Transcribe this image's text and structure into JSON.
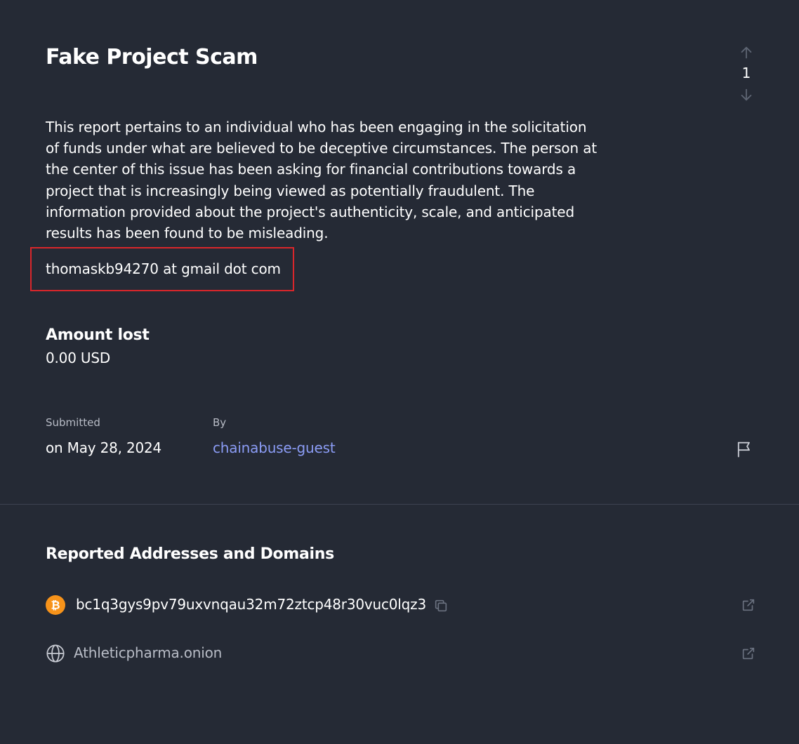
{
  "report": {
    "title": "Fake Project Scam",
    "description": "This report pertains to an individual who has been engaging in the solicitation of funds under what are believed to be deceptive circumstances. The person at the center of this issue has been asking for financial contributions towards a project that is increasingly being viewed as potentially fraudulent. The information provided about the project's authenticity, scale, and anticipated results has been found to be misleading.",
    "email": "thomaskb94270 at gmail dot com",
    "votes": "1"
  },
  "amount": {
    "label": "Amount lost",
    "value": "0.00 USD"
  },
  "meta": {
    "submitted_label": "Submitted",
    "submitted_value": "on May 28, 2024",
    "by_label": "By",
    "by_value": "chainabuse-guest"
  },
  "addresses": {
    "section_title": "Reported Addresses and Domains",
    "items": [
      {
        "type": "bitcoin",
        "icon": "bitcoin-icon",
        "value": "bc1q3gys9pv79uxvnqau32m72ztcp48r30vuc0lqz3"
      },
      {
        "type": "domain",
        "icon": "globe-icon",
        "value": "Athleticpharma.onion"
      }
    ]
  },
  "colors": {
    "background": "#252a35",
    "highlight_border": "#d9262b",
    "link": "#8b9cf5",
    "bitcoin": "#f7931a",
    "muted": "#b8bcc6"
  }
}
